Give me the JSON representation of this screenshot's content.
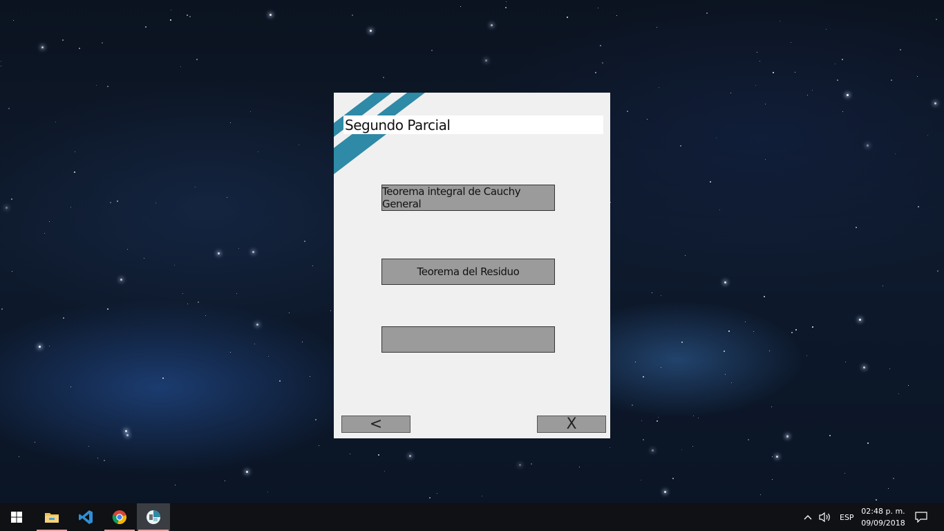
{
  "window": {
    "title": "Segundo Parcial",
    "buttons": [
      {
        "label": "Teorema integral de Cauchy General"
      },
      {
        "label": "Teorema del Residuo"
      },
      {
        "label": ""
      }
    ],
    "back_label": "<",
    "close_label": "X",
    "stripe_color": "#2e8aa6"
  },
  "taskbar": {
    "items": [
      {
        "name": "start-icon"
      },
      {
        "name": "file-explorer-icon"
      },
      {
        "name": "vscode-icon"
      },
      {
        "name": "chrome-icon"
      },
      {
        "name": "app-icon"
      }
    ],
    "tray": {
      "language": "ESP",
      "time": "02:48 p. m.",
      "date": "09/09/2018"
    }
  }
}
